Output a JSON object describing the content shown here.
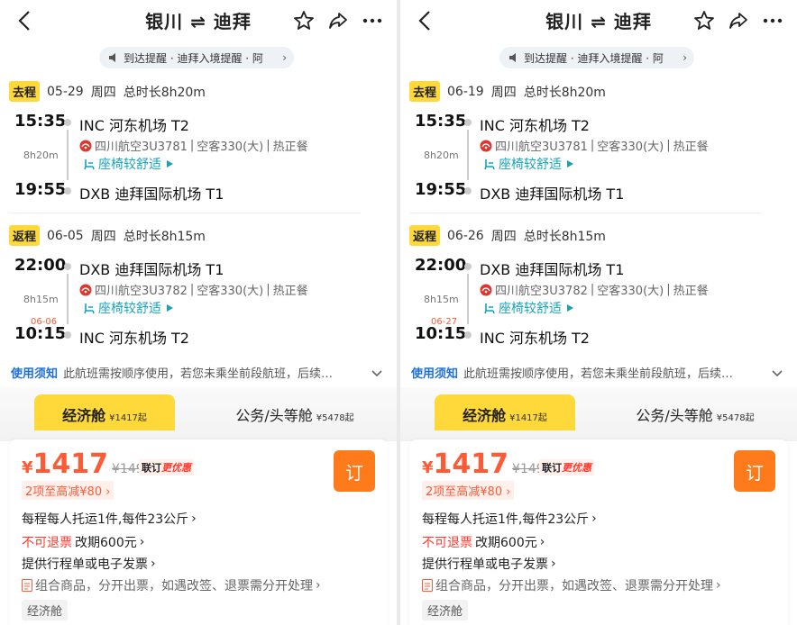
{
  "header": {
    "title": "银川 ⇌ 迪拜"
  },
  "notice_pill": {
    "text": "到达提醒 · 迪拜入境提醒 · 阿",
    "chevron": "›"
  },
  "rules": {
    "label": "使用须知",
    "text": "此航班需按顺序使用，若您未乘坐前段航班，后续…"
  },
  "panels": [
    {
      "outbound": {
        "tag": "去程",
        "date": "05-29",
        "weekday": "周四",
        "total": "总时长8h20m",
        "dep_time": "15:35",
        "dep_airport": "INC 河东机场 T2",
        "duration": "8h20m",
        "flight": "四川航空3U3781",
        "aircraft": "空客330(大)",
        "meal": "热正餐",
        "comfort": "座椅较舒适",
        "arr_time": "19:55",
        "arr_airport": "DXB 迪拜国际机场 T1"
      },
      "inbound": {
        "tag": "返程",
        "date": "06-05",
        "weekday": "周四",
        "total": "总时长8h15m",
        "dep_time": "22:00",
        "dep_airport": "DXB 迪拜国际机场 T1",
        "duration": "8h15m",
        "next_day": "06-06",
        "flight": "四川航空3U3782",
        "aircraft": "空客330(大)",
        "meal": "热正餐",
        "comfort": "座椅较舒适",
        "arr_time": "10:15",
        "arr_airport": "INC 河东机场 T2"
      }
    },
    {
      "outbound": {
        "tag": "去程",
        "date": "06-19",
        "weekday": "周四",
        "total": "总时长8h20m",
        "dep_time": "15:35",
        "dep_airport": "INC 河东机场 T2",
        "duration": "8h20m",
        "flight": "四川航空3U3781",
        "aircraft": "空客330(大)",
        "meal": "热正餐",
        "comfort": "座椅较舒适",
        "arr_time": "19:55",
        "arr_airport": "DXB 迪拜国际机场 T1"
      },
      "inbound": {
        "tag": "返程",
        "date": "06-26",
        "weekday": "周四",
        "total": "总时长8h15m",
        "dep_time": "22:00",
        "dep_airport": "DXB 迪拜国际机场 T1",
        "duration": "8h15m",
        "next_day": "06-27",
        "flight": "四川航空3U3782",
        "aircraft": "空客330(大)",
        "meal": "热正餐",
        "comfort": "座椅较舒适",
        "arr_time": "10:15",
        "arr_airport": "INC 河东机场 T2"
      }
    }
  ],
  "cabins": {
    "economy": {
      "label": "经济舱",
      "price": "¥1417起"
    },
    "business": {
      "label": "公务/头等舱",
      "price": "¥5478起"
    }
  },
  "offer": {
    "currency": "¥",
    "price": "1417",
    "original_price": "¥1497",
    "promo_prefix": "联订",
    "promo_suffix": "更优惠",
    "discount": "2项至高减¥80",
    "book_label": "订",
    "baggage": "每程每人托运1件,每件23公斤",
    "refund_red": "不可退票",
    "change_fee": "改期600元",
    "invoice": "提供行程单或电子发票",
    "combo": "组合商品，分开出票，如遇改签、退票需分开处理",
    "cabin_tag": "经济舱"
  },
  "colors": {
    "accent_yellow": "#ffd83a",
    "price_red": "#ff5a36",
    "book_orange": "#ff7a1a",
    "link_blue": "#1e6fd9",
    "comfort_teal": "#17a2b8"
  },
  "icons": [
    "back-arrow-icon",
    "star-icon",
    "share-icon",
    "more-icon",
    "speaker-icon",
    "airline-logo-icon",
    "seat-icon",
    "play-icon",
    "chevron-down-icon",
    "document-icon"
  ]
}
